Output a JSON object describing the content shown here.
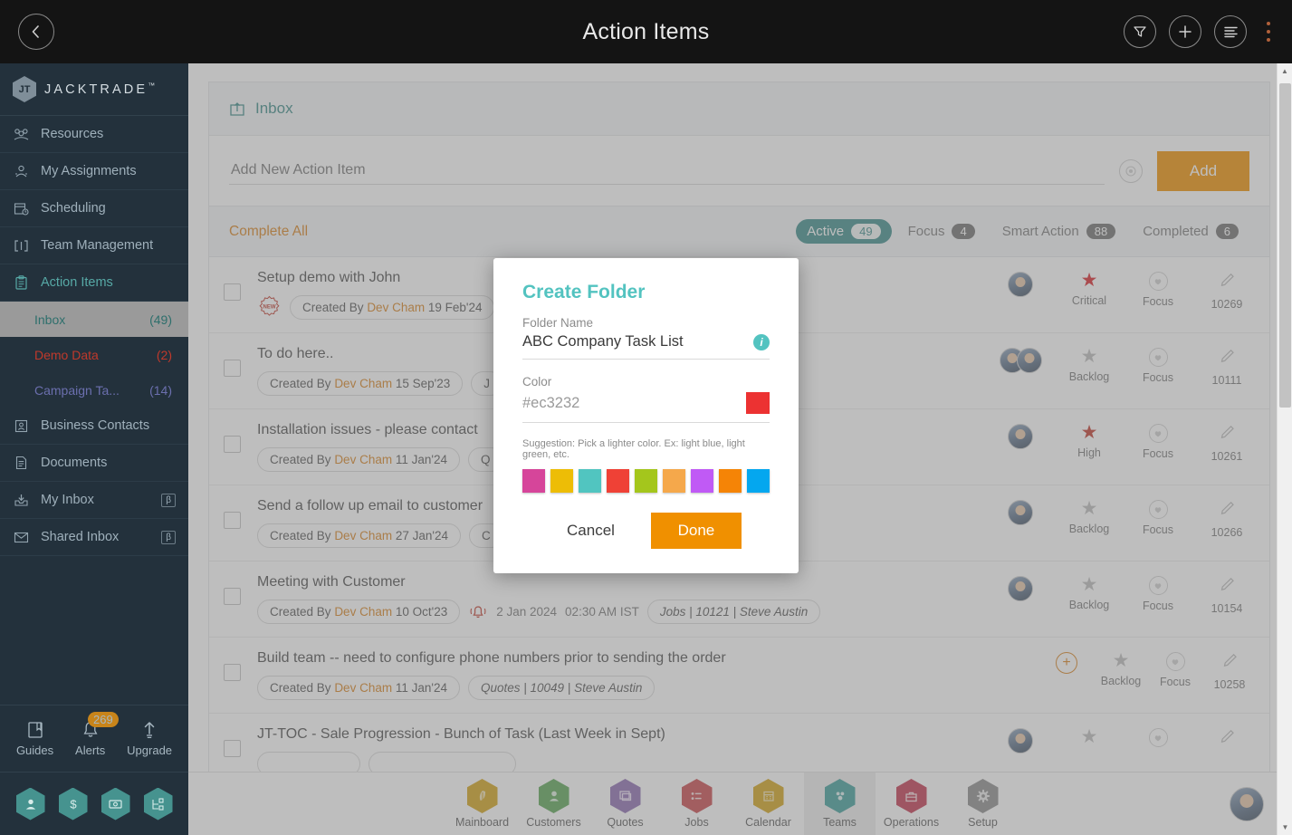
{
  "topbar": {
    "title": "Action Items",
    "back_icon": "chevron-left-icon",
    "filter_icon": "funnel-icon",
    "add_icon": "plus-icon",
    "list_icon": "list-lines-icon",
    "kebab_icon": "more-vertical-icon"
  },
  "sidebar": {
    "brand": "JACKTRADE",
    "brand_tm": "™",
    "items": [
      {
        "label": "Resources",
        "icon": "resources-icon"
      },
      {
        "label": "My Assignments",
        "icon": "assignments-icon"
      },
      {
        "label": "Scheduling",
        "icon": "calendar-clock-icon"
      },
      {
        "label": "Team Management",
        "icon": "team-brackets-icon"
      },
      {
        "label": "Action Items",
        "icon": "clipboard-icon",
        "active": true
      }
    ],
    "subitems": [
      {
        "label": "Inbox",
        "count": "(49)",
        "state": "selected"
      },
      {
        "label": "Demo Data",
        "count": "(2)",
        "state": "demo"
      },
      {
        "label": "Campaign Ta...",
        "count": "(14)",
        "state": "campaign"
      }
    ],
    "items_after": [
      {
        "label": "Business Contacts",
        "icon": "contact-card-icon",
        "beta": ""
      },
      {
        "label": "Documents",
        "icon": "documents-icon",
        "beta": ""
      },
      {
        "label": "My Inbox",
        "icon": "inbox-down-icon",
        "beta": "β"
      },
      {
        "label": "Shared Inbox",
        "icon": "envelope-icon",
        "beta": "β"
      }
    ],
    "bottom": [
      {
        "label": "Guides",
        "icon": "book-icon",
        "badge": ""
      },
      {
        "label": "Alerts",
        "icon": "bell-icon",
        "badge": "269"
      },
      {
        "label": "Upgrade",
        "icon": "arrow-up-icon",
        "badge": ""
      }
    ],
    "quick_hex": [
      "person-icon",
      "dollar-icon",
      "money-exchange-icon",
      "workflow-icon"
    ]
  },
  "main": {
    "inbox_header": {
      "label": "Inbox",
      "icon": "inbox-folder-icon"
    },
    "add_input": {
      "placeholder": "Add New Action Item",
      "value": ""
    },
    "add_target_icon": "target-icon",
    "add_button": "Add",
    "complete_all": "Complete All",
    "tabs": [
      {
        "label": "Active",
        "count": "49",
        "selected": true
      },
      {
        "label": "Focus",
        "count": "4",
        "selected": false
      },
      {
        "label": "Smart Action",
        "count": "88",
        "selected": false
      },
      {
        "label": "Completed",
        "count": "6",
        "selected": false
      }
    ],
    "rows": [
      {
        "title": "Setup demo with John",
        "new_badge": "NEW",
        "created_prefix": "Created By",
        "created_by": "Dev Cham",
        "created_date": "19 Feb'24",
        "extra_tag": "",
        "avatars": 1,
        "priority": "Critical",
        "priority_level": "critical",
        "focus": "Focus",
        "id": "10269"
      },
      {
        "title": "To do here..",
        "new_badge": "",
        "created_prefix": "Created By",
        "created_by": "Dev Cham",
        "created_date": "15 Sep'23",
        "extra_tag": "J",
        "avatars": 2,
        "priority": "Backlog",
        "priority_level": "backlog",
        "focus": "Focus",
        "id": "10111"
      },
      {
        "title": "Installation issues - please contact",
        "new_badge": "",
        "created_prefix": "Created By",
        "created_by": "Dev Cham",
        "created_date": "11 Jan'24",
        "extra_tag": "Q",
        "avatars": 1,
        "priority": "High",
        "priority_level": "high",
        "focus": "Focus",
        "id": "10261"
      },
      {
        "title": "Send a follow up email to customer",
        "new_badge": "",
        "created_prefix": "Created By",
        "created_by": "Dev Cham",
        "created_date": "27 Jan'24",
        "extra_tag": "C",
        "avatars": 1,
        "priority": "Backlog",
        "priority_level": "backlog",
        "focus": "Focus",
        "id": "10266"
      },
      {
        "title": "Meeting with Customer",
        "new_badge": "",
        "created_prefix": "Created By",
        "created_by": "Dev Cham",
        "created_date": "10 Oct'23",
        "alarm_icon": "alarm-bell-icon",
        "alarm_date": "2 Jan 2024",
        "alarm_time": "02:30 AM IST",
        "ref_tag": "Jobs | 10121 | Steve Austin",
        "avatars": 1,
        "priority": "Backlog",
        "priority_level": "backlog",
        "focus": "Focus",
        "id": "10154"
      },
      {
        "title": "Build team -- need to configure phone numbers prior to sending the order",
        "new_badge": "",
        "created_prefix": "Created By",
        "created_by": "Dev Cham",
        "created_date": "11 Jan'24",
        "ref_tag": "Quotes | 10049 | Steve Austin",
        "avatars": 0,
        "add_assignee_icon": "plus-circle-icon",
        "priority": "Backlog",
        "priority_level": "backlog",
        "focus": "Focus",
        "id": "10258"
      },
      {
        "title": "JT-TOC - Sale Progression - Bunch of Task (Last Week in Sept)",
        "new_badge": "",
        "created_prefix": "",
        "created_by": "",
        "created_date": "",
        "avatars": 1,
        "priority": "",
        "priority_level": "backlog",
        "focus": "",
        "id": ""
      }
    ]
  },
  "modal": {
    "title": "Create Folder",
    "name_label": "Folder Name",
    "name_value": "ABC Company Task List",
    "info_icon": "info-icon",
    "color_label": "Color",
    "color_value": "#ec3232",
    "color_chip": "#ec3232",
    "suggestion": "Suggestion: Pick a lighter color. Ex: light blue, light green, etc.",
    "swatches": [
      "#d6459a",
      "#edbd06",
      "#51c5c0",
      "#ef4136",
      "#a4c61c",
      "#f5a council",
      "#c05af5",
      "#f58406",
      "#04a7ef"
    ],
    "swatch_colors": [
      "#d6459a",
      "#edbd06",
      "#51c5c0",
      "#ef4136",
      "#a4c61c",
      "#f5a84b",
      "#c05af5",
      "#f58406",
      "#04a7ef"
    ],
    "cancel": "Cancel",
    "done": "Done"
  },
  "bottomnav": {
    "items": [
      {
        "label": "Mainboard",
        "color": "#d3a418",
        "icon": "feather-icon"
      },
      {
        "label": "Customers",
        "color": "#5aa555",
        "icon": "person-icon"
      },
      {
        "label": "Quotes",
        "color": "#8c6bb1",
        "icon": "quote-pages-icon"
      },
      {
        "label": "Jobs",
        "color": "#c9474b",
        "icon": "task-list-icon"
      },
      {
        "label": "Calendar",
        "color": "#d3a418",
        "icon": "calendar-icon"
      },
      {
        "label": "Teams",
        "color": "#3f9e9a",
        "icon": "teams-icon",
        "active": true
      },
      {
        "label": "Operations",
        "color": "#c2374f",
        "icon": "briefcase-icon"
      },
      {
        "label": "Setup",
        "color": "#8c8c8c",
        "icon": "gear-icon"
      }
    ],
    "profile_avatar": "user-avatar"
  }
}
